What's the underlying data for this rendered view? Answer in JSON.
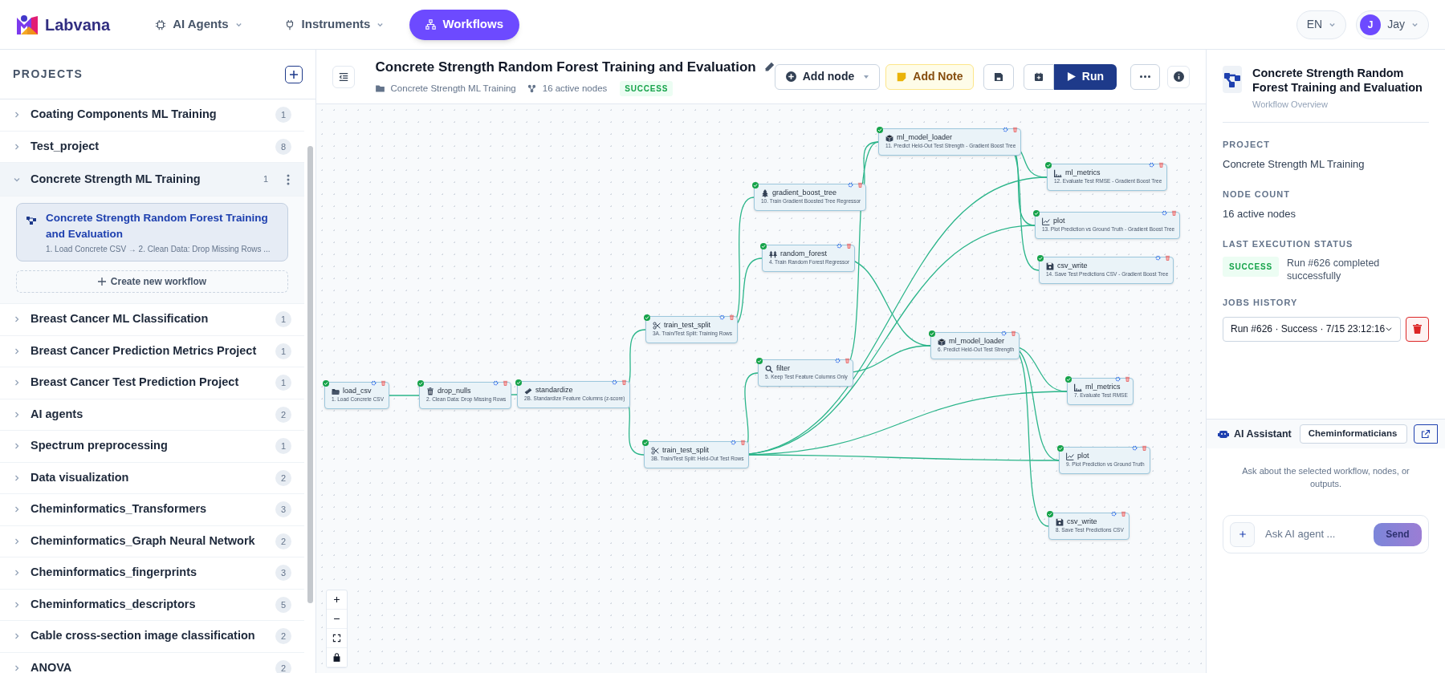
{
  "nav": {
    "brand": "Labvana",
    "items": [
      {
        "label": "AI Agents",
        "kind": "menu",
        "selected": false
      },
      {
        "label": "Instruments",
        "kind": "menu",
        "selected": false
      },
      {
        "label": "Workflows",
        "kind": "link",
        "selected": true
      }
    ],
    "language": "EN",
    "user": {
      "initial": "J",
      "name": "Jay"
    }
  },
  "sidebar": {
    "title": "PROJECTS",
    "projects": [
      {
        "name": "Coating Components ML Training",
        "count": "1",
        "expanded": false
      },
      {
        "name": "Test_project",
        "count": "8",
        "expanded": false
      },
      {
        "name": "Concrete Strength ML Training",
        "count": "1",
        "expanded": true,
        "workflows": [
          {
            "title": "Concrete Strength Random Forest Training and Evaluation",
            "steps": "1. Load Concrete CSV → 2. Clean Data: Drop Missing Rows ...",
            "selected": true
          }
        ],
        "create_label": "Create new workflow"
      },
      {
        "name": "Breast Cancer ML Classification",
        "count": "1",
        "expanded": false
      },
      {
        "name": "Breast Cancer Prediction Metrics Project",
        "count": "1",
        "expanded": false
      },
      {
        "name": "Breast Cancer Test Prediction Project",
        "count": "1",
        "expanded": false
      },
      {
        "name": "AI agents",
        "count": "2",
        "expanded": false
      },
      {
        "name": "Spectrum preprocessing",
        "count": "1",
        "expanded": false
      },
      {
        "name": "Data visualization",
        "count": "2",
        "expanded": false
      },
      {
        "name": "Cheminformatics_Transformers",
        "count": "3",
        "expanded": false
      },
      {
        "name": "Cheminformatics_Graph Neural Network",
        "count": "2",
        "expanded": false
      },
      {
        "name": "Cheminformatics_fingerprints",
        "count": "3",
        "expanded": false
      },
      {
        "name": "Cheminformatics_descriptors",
        "count": "5",
        "expanded": false
      },
      {
        "name": "Cable cross-section image classification",
        "count": "2",
        "expanded": false
      },
      {
        "name": "ANOVA",
        "count": "2",
        "expanded": false
      }
    ]
  },
  "workflow": {
    "title": "Concrete Strength Random Forest Training and Evaluation",
    "project": "Concrete Strength ML Training",
    "node_count": "16 active nodes",
    "status": "SUCCESS",
    "add_node": "Add node",
    "add_note": "Add Note",
    "run": "Run"
  },
  "nodes": [
    {
      "name": "load_csv",
      "subtitle": "1. Load Concrete CSV",
      "kind": "load",
      "done": true
    },
    {
      "name": "drop_nulls",
      "subtitle": "2. Clean Data: Drop Missing Rows",
      "kind": "clean",
      "done": true
    },
    {
      "name": "standardize",
      "subtitle": "2B. Standardize Feature Columns (z-score)",
      "kind": "scale",
      "done": true
    },
    {
      "name": "train_test_split",
      "subtitle": "3A. Train/Test Split: Training Rows",
      "kind": "split",
      "done": true
    },
    {
      "name": "train_test_split",
      "subtitle": "3B. Train/Test Split: Held-Out Test Rows",
      "kind": "split",
      "done": true
    },
    {
      "name": "gradient_boost_tree",
      "subtitle": "10. Train Gradient Boosted Tree Regressor",
      "kind": "boost",
      "done": true
    },
    {
      "name": "random_forest",
      "subtitle": "4. Train Random Forest Regressor",
      "kind": "forest",
      "done": true
    },
    {
      "name": "filter",
      "subtitle": "5. Keep Test Feature Columns Only",
      "kind": "filter",
      "done": true
    },
    {
      "name": "ml_model_loader",
      "subtitle": "11. Predict Held-Out Test Strength - Gradient Boost Tree",
      "kind": "model",
      "done": true
    },
    {
      "name": "ml_model_loader",
      "subtitle": "6. Predict Held-Out Test Strength",
      "kind": "model",
      "done": true
    },
    {
      "name": "ml_metrics",
      "subtitle": "12. Evaluate Test RMSE - Gradient Boost Tree",
      "kind": "metrics",
      "done": true
    },
    {
      "name": "plot",
      "subtitle": "13. Plot Prediction vs Ground Truth - Gradient Boost Tree",
      "kind": "plot",
      "done": true
    },
    {
      "name": "csv_write",
      "subtitle": "14. Save Test Predictions CSV - Gradient Boost Tree",
      "kind": "save",
      "done": true
    },
    {
      "name": "ml_metrics",
      "subtitle": "7. Evaluate Test RMSE",
      "kind": "metrics",
      "done": true
    },
    {
      "name": "plot",
      "subtitle": "9. Plot Prediction vs Ground Truth",
      "kind": "plot",
      "done": true
    },
    {
      "name": "csv_write",
      "subtitle": "8. Save Test Predictions CSV",
      "kind": "save",
      "done": true
    }
  ],
  "overview": {
    "title": "Concrete Strength Random Forest Training and Evaluation",
    "subtitle": "Workflow Overview",
    "fields": [
      {
        "label": "PROJECT",
        "value": "Concrete Strength ML Training"
      },
      {
        "label": "NODE COUNT",
        "value": "16 active nodes"
      }
    ],
    "status_label": "LAST EXECUTION STATUS",
    "status": "SUCCESS",
    "status_message": "Run #626 completed successfully",
    "jobs_label": "JOBS HISTORY",
    "job": "Run #626 · Success · 7/15 23:12:16"
  },
  "assistant": {
    "title": "AI Assistant",
    "agent": "Cheminformaticians",
    "hint": "Ask about the selected workflow, nodes, or outputs.",
    "placeholder": "Ask AI agent ...",
    "send": "Send",
    "send_disabled": true
  }
}
